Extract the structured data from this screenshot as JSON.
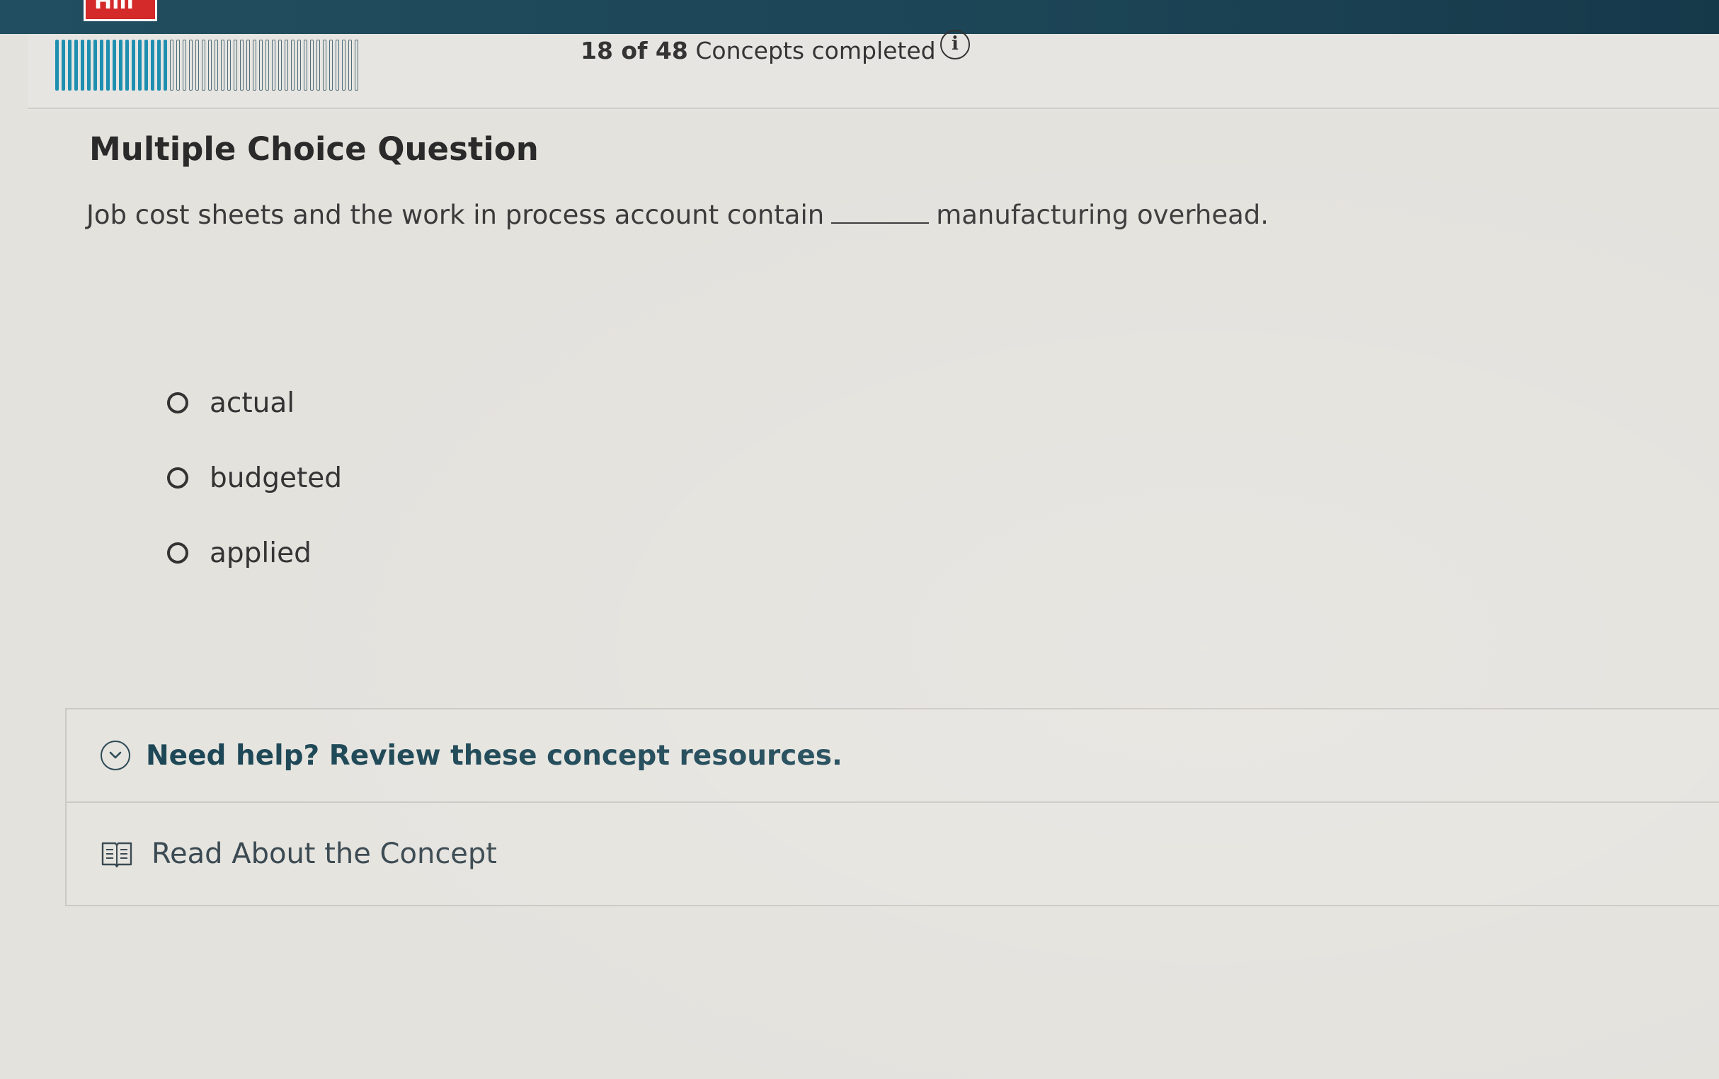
{
  "header": {
    "logo_text": "Hill",
    "brand_color": "#d42a2a",
    "bar_color": "#1c4556"
  },
  "progress": {
    "completed": 18,
    "total": 48,
    "count_text": "18 of 48",
    "suffix_text": "Concepts completed",
    "info_icon": "info-icon",
    "done_color": "#1e8fb0"
  },
  "question": {
    "title": "Multiple Choice Question",
    "text_before": "Job cost sheets and the work in process account contain",
    "text_after": "manufacturing overhead."
  },
  "options": [
    {
      "label": "actual",
      "selected": false
    },
    {
      "label": "budgeted",
      "selected": false
    },
    {
      "label": "applied",
      "selected": false
    }
  ],
  "help": {
    "title": "Need help? Review these concept resources.",
    "expand_icon": "chevron-down-icon",
    "items": [
      {
        "label": "Read About the Concept",
        "icon": "book-icon"
      }
    ]
  }
}
